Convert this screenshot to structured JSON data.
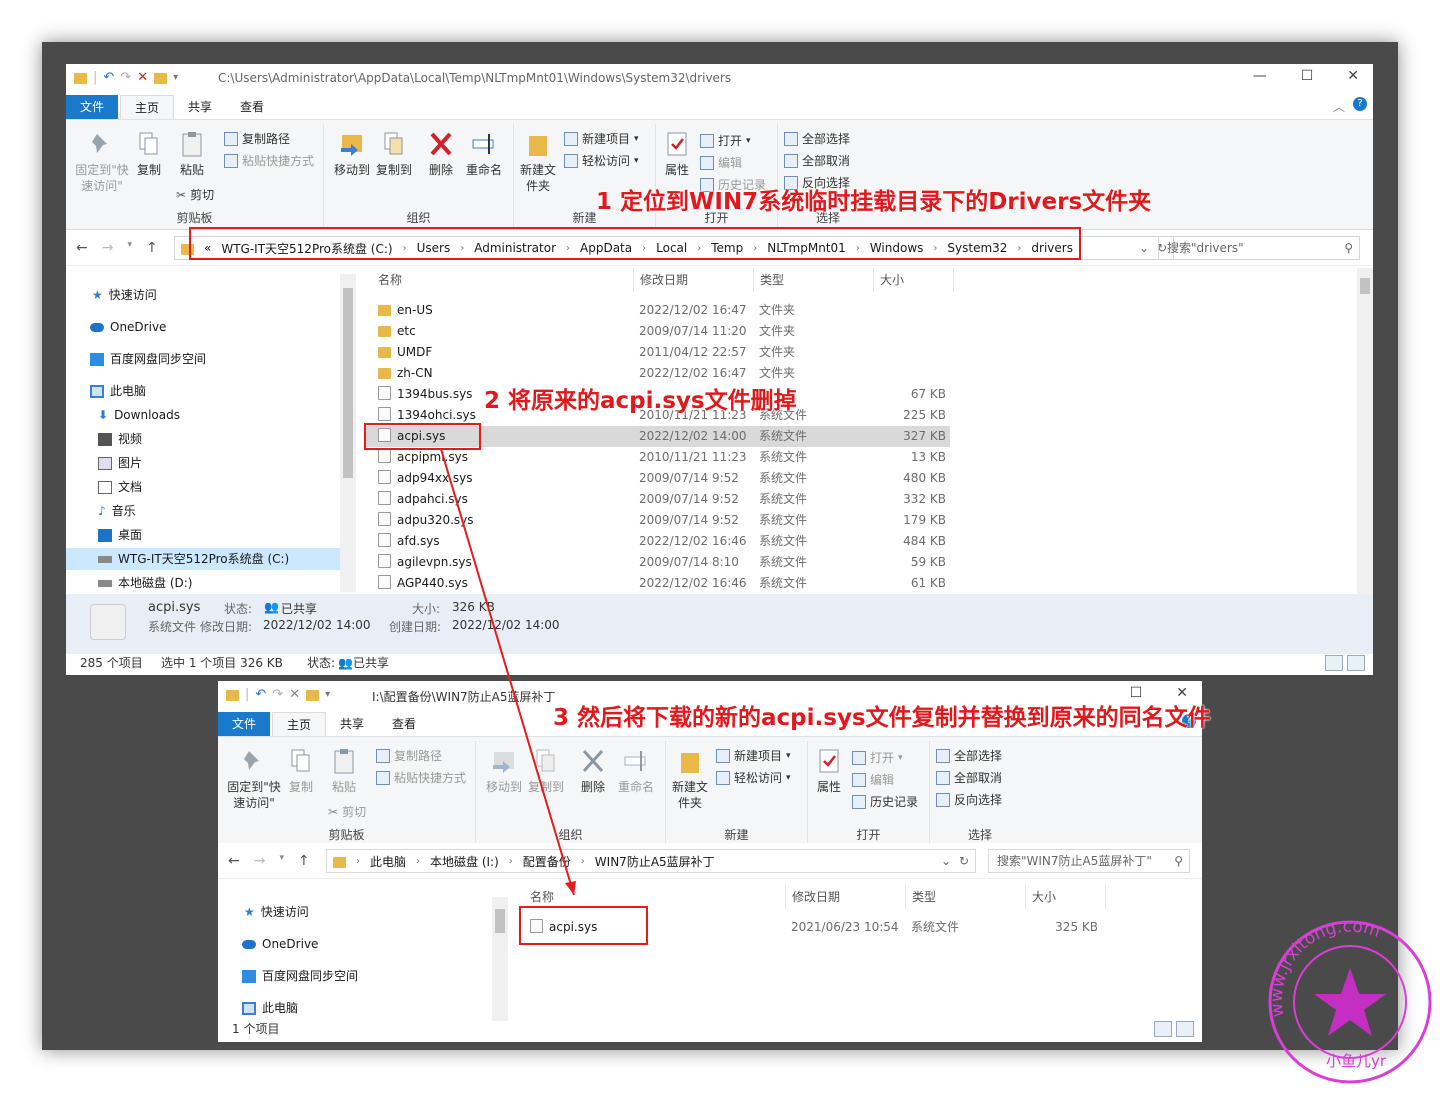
{
  "top_window": {
    "title_path": "C:\\Users\\Administrator\\AppData\\Local\\Temp\\NLTmpMnt01\\Windows\\System32\\drivers",
    "tabs": [
      "文件",
      "主页",
      "共享",
      "查看"
    ],
    "ribbon": {
      "pin": "固定到\"快速访问\"",
      "copy": "复制",
      "paste": "粘贴",
      "copy_path": "复制路径",
      "paste_shortcut": "粘贴快捷方式",
      "cut": "剪切",
      "clipboard_group": "剪贴板",
      "move_to": "移动到",
      "copy_to": "复制到",
      "delete": "删除",
      "rename": "重命名",
      "organize_group": "组织",
      "new_folder": "新建文件夹",
      "new_item": "新建项目",
      "easy_access": "轻松访问",
      "new_group": "新建",
      "properties": "属性",
      "open": "打开",
      "edit": "编辑",
      "history": "历史记录",
      "open_group": "打开",
      "select_all": "全部选择",
      "select_none": "全部取消",
      "invert_selection": "反向选择",
      "select_group": "选择"
    },
    "address": {
      "prefix": "«",
      "crumbs": [
        "WTG-IT天空512Pro系统盘 (C:)",
        "Users",
        "Administrator",
        "AppData",
        "Local",
        "Temp",
        "NLTmpMnt01",
        "Windows",
        "System32",
        "drivers"
      ]
    },
    "search_placeholder": "搜索\"drivers\"",
    "nav": [
      {
        "label": "快速访问",
        "icon": "star-icon"
      },
      {
        "label": "OneDrive",
        "icon": "cloud-icon"
      },
      {
        "label": "百度网盘同步空间",
        "icon": "baidu-sync-icon"
      },
      {
        "label": "此电脑",
        "icon": "computer-icon"
      },
      {
        "label": "Downloads",
        "icon": "download-icon"
      },
      {
        "label": "视频",
        "icon": "video-icon"
      },
      {
        "label": "图片",
        "icon": "picture-icon"
      },
      {
        "label": "文档",
        "icon": "document-icon"
      },
      {
        "label": "音乐",
        "icon": "music-icon"
      },
      {
        "label": "桌面",
        "icon": "desktop-icon"
      },
      {
        "label": "WTG-IT天空512Pro系统盘 (C:)",
        "icon": "drive-icon"
      },
      {
        "label": "本地磁盘 (D:)",
        "icon": "drive-icon"
      }
    ],
    "columns": [
      "名称",
      "修改日期",
      "类型",
      "大小"
    ],
    "files": [
      {
        "name": "en-US",
        "date": "2022/12/02 16:47",
        "type": "文件夹",
        "size": "",
        "kind": "folder"
      },
      {
        "name": "etc",
        "date": "2009/07/14 11:20",
        "type": "文件夹",
        "size": "",
        "kind": "folder"
      },
      {
        "name": "UMDF",
        "date": "2011/04/12 22:57",
        "type": "文件夹",
        "size": "",
        "kind": "folder"
      },
      {
        "name": "zh-CN",
        "date": "2022/12/02 16:47",
        "type": "文件夹",
        "size": "",
        "kind": "folder"
      },
      {
        "name": "1394bus.sys",
        "date": "",
        "type": "",
        "size": "67 KB",
        "kind": "sys"
      },
      {
        "name": "1394ohci.sys",
        "date": "2010/11/21 11:23",
        "type": "系统文件",
        "size": "225 KB",
        "kind": "sys"
      },
      {
        "name": "acpi.sys",
        "date": "2022/12/02 14:00",
        "type": "系统文件",
        "size": "327 KB",
        "kind": "sys"
      },
      {
        "name": "acpipmi.sys",
        "date": "2010/11/21 11:23",
        "type": "系统文件",
        "size": "13 KB",
        "kind": "sys"
      },
      {
        "name": "adp94xx.sys",
        "date": "2009/07/14 9:52",
        "type": "系统文件",
        "size": "480 KB",
        "kind": "sys"
      },
      {
        "name": "adpahci.sys",
        "date": "2009/07/14 9:52",
        "type": "系统文件",
        "size": "332 KB",
        "kind": "sys"
      },
      {
        "name": "adpu320.sys",
        "date": "2009/07/14 9:52",
        "type": "系统文件",
        "size": "179 KB",
        "kind": "sys"
      },
      {
        "name": "afd.sys",
        "date": "2022/12/02 16:46",
        "type": "系统文件",
        "size": "484 KB",
        "kind": "sys"
      },
      {
        "name": "agilevpn.sys",
        "date": "2009/07/14 8:10",
        "type": "系统文件",
        "size": "59 KB",
        "kind": "sys"
      },
      {
        "name": "AGP440.sys",
        "date": "2022/12/02 16:46",
        "type": "系统文件",
        "size": "61 KB",
        "kind": "sys"
      }
    ],
    "details": {
      "name": "acpi.sys",
      "type": "系统文件",
      "state_label": "状态:",
      "state_value": "已共享",
      "modified_label": "修改日期:",
      "modified_value": "2022/12/02 14:00",
      "size_label": "大小:",
      "size_value": "326 KB",
      "created_label": "创建日期:",
      "created_value": "2022/12/02 14:00"
    },
    "status": {
      "count": "285 个项目",
      "selected": "选中 1 个项目  326 KB",
      "state": "状态:",
      "shared": "已共享"
    }
  },
  "bottom_window": {
    "title_path": "I:\\配置备份\\WIN7防止A5蓝屏补丁",
    "tabs": [
      "文件",
      "主页",
      "共享",
      "查看"
    ],
    "address": {
      "crumbs": [
        "此电脑",
        "本地磁盘 (I:)",
        "配置备份",
        "WIN7防止A5蓝屏补丁"
      ]
    },
    "search_placeholder": "搜索\"WIN7防止A5蓝屏补丁\"",
    "nav": [
      {
        "label": "快速访问",
        "icon": "star-icon"
      },
      {
        "label": "OneDrive",
        "icon": "cloud-icon"
      },
      {
        "label": "百度网盘同步空间",
        "icon": "baidu-sync-icon"
      },
      {
        "label": "此电脑",
        "icon": "computer-icon"
      }
    ],
    "columns": [
      "名称",
      "修改日期",
      "类型",
      "大小"
    ],
    "files": [
      {
        "name": "acpi.sys",
        "date": "2021/06/23 10:54",
        "type": "系统文件",
        "size": "325 KB",
        "kind": "sys"
      }
    ],
    "status": {
      "count": "1 个项目"
    }
  },
  "annotations": {
    "step1": "1  定位到WIN7系统临时挂载目录下的Drivers文件夹",
    "step2": "2   将原来的acpi.sys文件删掉",
    "step3": "3  然后将下载的新的acpi.sys文件复制并替换到原来的同名文件"
  },
  "watermark": {
    "text": "www.jrxitong.com",
    "sub": "小鱼儿yr"
  },
  "colors": {
    "accent": "#1979ca",
    "annotation": "#e0191c",
    "selection": "#d9d9d9",
    "watermark": "#d83fd4"
  }
}
